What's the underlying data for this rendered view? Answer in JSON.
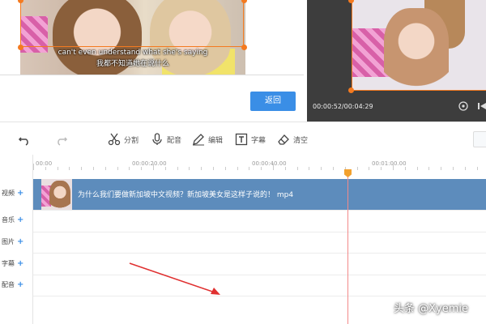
{
  "source_panel": {
    "subtitle_en": "can't even understand what she's saying",
    "subtitle_zh": "我都不知道她在说什么",
    "back_button": "返回"
  },
  "preview": {
    "timecode": "00:00:52/00:04:29"
  },
  "toolbar": {
    "split": "分割",
    "dub": "配音",
    "edit": "编辑",
    "subtitle": "字幕",
    "clear": "清空"
  },
  "timeline": {
    "ticks": [
      "00:00",
      "00:00:20.00",
      "00:00:40.00",
      "00:01:00.00"
    ],
    "tracks": [
      "视频",
      "音乐",
      "图片",
      "字幕",
      "配音"
    ],
    "clip_title": "为什么我们要做新加坡中文视频？新加坡美女是这样子说的！ mp4"
  },
  "watermark": "头条 @Xyemie",
  "colors": {
    "accent_orange": "#f47a20",
    "button_blue": "#3a8ee6",
    "clip_blue": "#5d8cbc",
    "playhead_red": "#f28a8a"
  }
}
